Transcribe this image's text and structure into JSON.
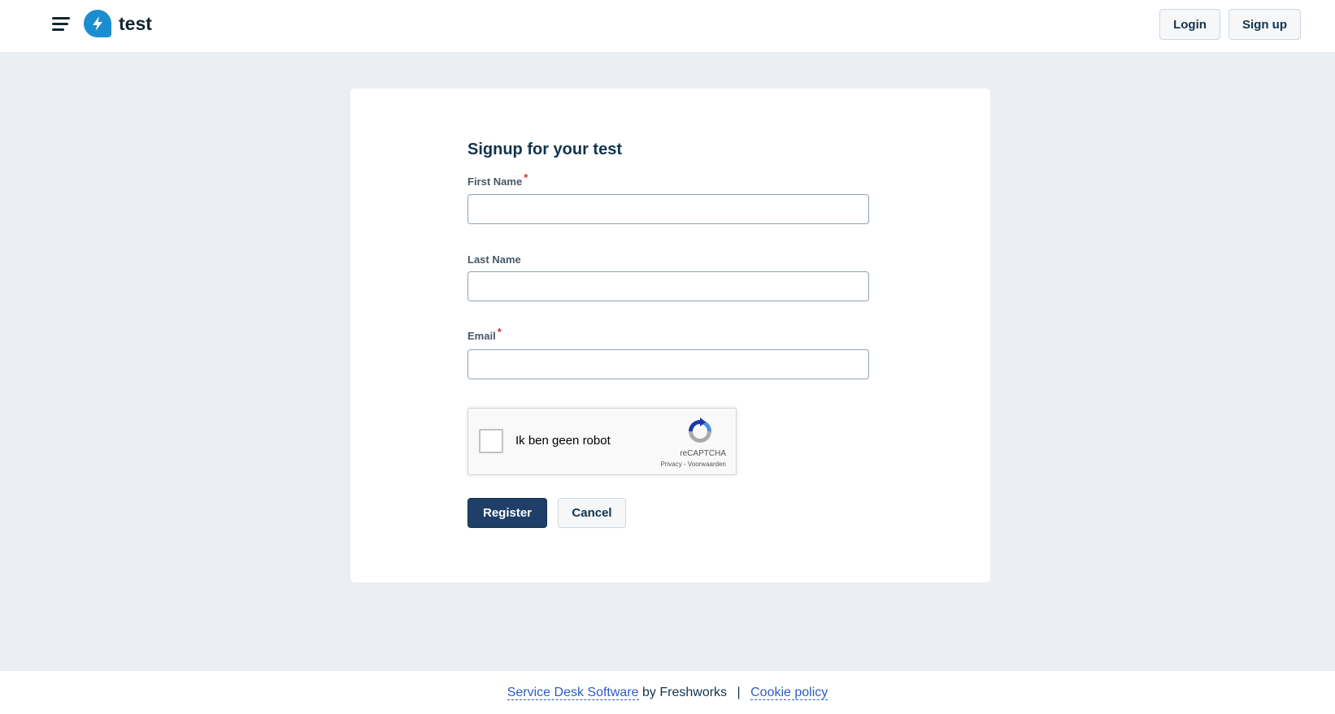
{
  "header": {
    "brand": "test",
    "login_label": "Login",
    "signup_label": "Sign up"
  },
  "form": {
    "title": "Signup for your test",
    "first_name": {
      "label": "First Name",
      "required": "*",
      "value": ""
    },
    "last_name": {
      "label": "Last Name",
      "value": ""
    },
    "email": {
      "label": "Email",
      "required": "*",
      "value": ""
    },
    "captcha": {
      "label": "Ik ben geen robot",
      "brand": "reCAPTCHA",
      "privacy": "Privacy",
      "separator": "-",
      "terms": "Voorwaarden"
    },
    "register_label": "Register",
    "cancel_label": "Cancel"
  },
  "footer": {
    "link1": "Service Desk Software",
    "by_text": "by Freshworks",
    "separator": "|",
    "link2": "Cookie policy"
  },
  "colors": {
    "primary": "#1f3f68",
    "logo_blue": "#1b8ed1",
    "page_bg": "#ebeef3",
    "link": "#2c5cc5",
    "required": "#d72d30"
  }
}
